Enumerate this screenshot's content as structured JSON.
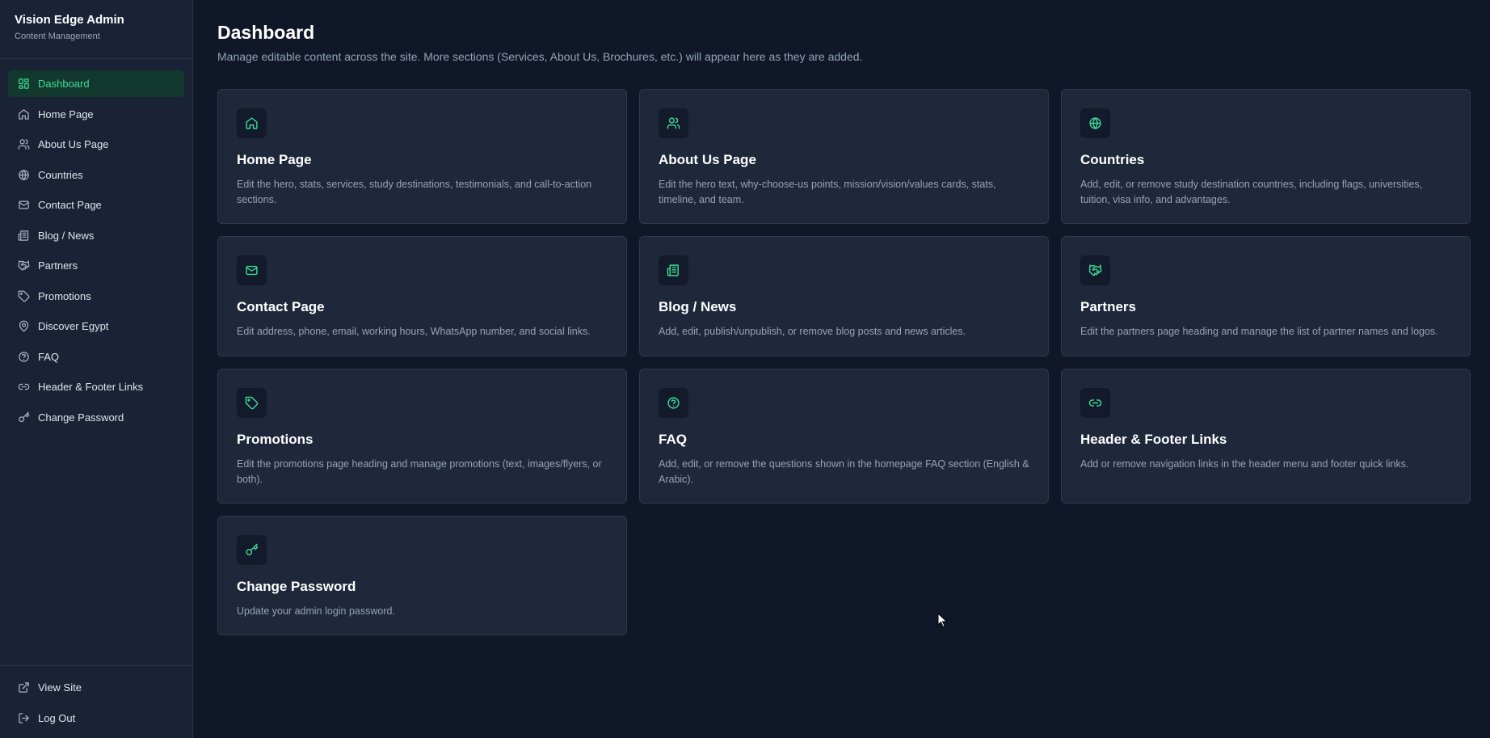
{
  "brand": {
    "title": "Vision Edge Admin",
    "subtitle": "Content Management"
  },
  "sidebar": {
    "items": [
      {
        "label": "Dashboard",
        "icon": "dashboard-icon",
        "active": true
      },
      {
        "label": "Home Page",
        "icon": "home-icon"
      },
      {
        "label": "About Us Page",
        "icon": "users-icon"
      },
      {
        "label": "Countries",
        "icon": "globe-icon"
      },
      {
        "label": "Contact Page",
        "icon": "mail-icon"
      },
      {
        "label": "Blog / News",
        "icon": "newspaper-icon"
      },
      {
        "label": "Partners",
        "icon": "handshake-icon"
      },
      {
        "label": "Promotions",
        "icon": "tag-icon"
      },
      {
        "label": "Discover Egypt",
        "icon": "map-pin-icon"
      },
      {
        "label": "FAQ",
        "icon": "help-circle-icon"
      },
      {
        "label": "Header & Footer Links",
        "icon": "link-icon"
      },
      {
        "label": "Change Password",
        "icon": "key-icon"
      }
    ],
    "footer": [
      {
        "label": "View Site",
        "icon": "external-link-icon"
      },
      {
        "label": "Log Out",
        "icon": "log-out-icon"
      }
    ]
  },
  "main": {
    "title": "Dashboard",
    "description": "Manage editable content across the site. More sections (Services, About Us, Brochures, etc.) will appear here as they are added.",
    "cards": [
      {
        "title": "Home Page",
        "icon": "home-icon",
        "description": "Edit the hero, stats, services, study destinations, testimonials, and call-to-action sections."
      },
      {
        "title": "About Us Page",
        "icon": "users-icon",
        "description": "Edit the hero text, why-choose-us points, mission/vision/values cards, stats, timeline, and team."
      },
      {
        "title": "Countries",
        "icon": "globe-icon",
        "description": "Add, edit, or remove study destination countries, including flags, universities, tuition, visa info, and advantages."
      },
      {
        "title": "Contact Page",
        "icon": "mail-icon",
        "description": "Edit address, phone, email, working hours, WhatsApp number, and social links."
      },
      {
        "title": "Blog / News",
        "icon": "newspaper-icon",
        "description": "Add, edit, publish/unpublish, or remove blog posts and news articles."
      },
      {
        "title": "Partners",
        "icon": "handshake-icon",
        "description": "Edit the partners page heading and manage the list of partner names and logos."
      },
      {
        "title": "Promotions",
        "icon": "tag-icon",
        "description": "Edit the promotions page heading and manage promotions (text, images/flyers, or both)."
      },
      {
        "title": "FAQ",
        "icon": "help-circle-icon",
        "description": "Add, edit, or remove the questions shown in the homepage FAQ section (English & Arabic)."
      },
      {
        "title": "Header & Footer Links",
        "icon": "link-icon",
        "description": "Add or remove navigation links in the header menu and footer quick links."
      },
      {
        "title": "Change Password",
        "icon": "key-icon",
        "description": "Update your admin login password."
      }
    ]
  },
  "colors": {
    "accent": "#3ddc97",
    "background": "#0f1729",
    "sidebar": "#1a2336",
    "card": "#1e283a"
  }
}
